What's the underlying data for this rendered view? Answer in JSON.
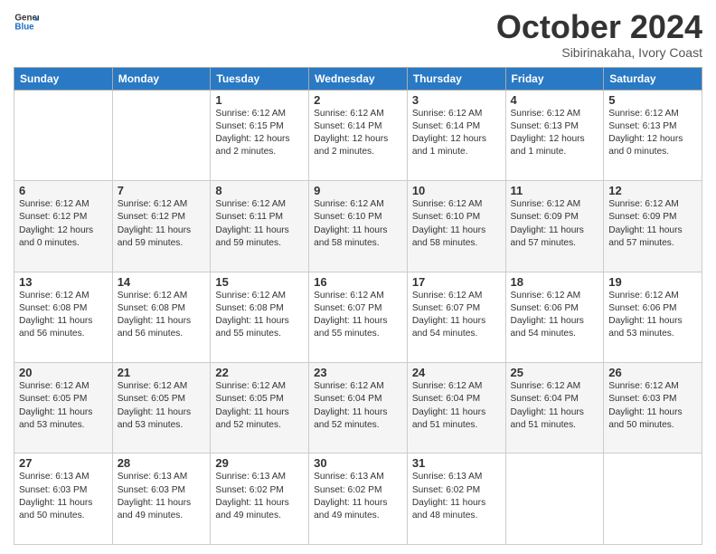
{
  "logo": {
    "line1": "General",
    "line2": "Blue"
  },
  "title": "October 2024",
  "subtitle": "Sibirinakaha, Ivory Coast",
  "weekdays": [
    "Sunday",
    "Monday",
    "Tuesday",
    "Wednesday",
    "Thursday",
    "Friday",
    "Saturday"
  ],
  "weeks": [
    [
      {
        "day": "",
        "info": ""
      },
      {
        "day": "",
        "info": ""
      },
      {
        "day": "1",
        "info": "Sunrise: 6:12 AM\nSunset: 6:15 PM\nDaylight: 12 hours and 2 minutes."
      },
      {
        "day": "2",
        "info": "Sunrise: 6:12 AM\nSunset: 6:14 PM\nDaylight: 12 hours and 2 minutes."
      },
      {
        "day": "3",
        "info": "Sunrise: 6:12 AM\nSunset: 6:14 PM\nDaylight: 12 hours and 1 minute."
      },
      {
        "day": "4",
        "info": "Sunrise: 6:12 AM\nSunset: 6:13 PM\nDaylight: 12 hours and 1 minute."
      },
      {
        "day": "5",
        "info": "Sunrise: 6:12 AM\nSunset: 6:13 PM\nDaylight: 12 hours and 0 minutes."
      }
    ],
    [
      {
        "day": "6",
        "info": "Sunrise: 6:12 AM\nSunset: 6:12 PM\nDaylight: 12 hours and 0 minutes."
      },
      {
        "day": "7",
        "info": "Sunrise: 6:12 AM\nSunset: 6:12 PM\nDaylight: 11 hours and 59 minutes."
      },
      {
        "day": "8",
        "info": "Sunrise: 6:12 AM\nSunset: 6:11 PM\nDaylight: 11 hours and 59 minutes."
      },
      {
        "day": "9",
        "info": "Sunrise: 6:12 AM\nSunset: 6:10 PM\nDaylight: 11 hours and 58 minutes."
      },
      {
        "day": "10",
        "info": "Sunrise: 6:12 AM\nSunset: 6:10 PM\nDaylight: 11 hours and 58 minutes."
      },
      {
        "day": "11",
        "info": "Sunrise: 6:12 AM\nSunset: 6:09 PM\nDaylight: 11 hours and 57 minutes."
      },
      {
        "day": "12",
        "info": "Sunrise: 6:12 AM\nSunset: 6:09 PM\nDaylight: 11 hours and 57 minutes."
      }
    ],
    [
      {
        "day": "13",
        "info": "Sunrise: 6:12 AM\nSunset: 6:08 PM\nDaylight: 11 hours and 56 minutes."
      },
      {
        "day": "14",
        "info": "Sunrise: 6:12 AM\nSunset: 6:08 PM\nDaylight: 11 hours and 56 minutes."
      },
      {
        "day": "15",
        "info": "Sunrise: 6:12 AM\nSunset: 6:08 PM\nDaylight: 11 hours and 55 minutes."
      },
      {
        "day": "16",
        "info": "Sunrise: 6:12 AM\nSunset: 6:07 PM\nDaylight: 11 hours and 55 minutes."
      },
      {
        "day": "17",
        "info": "Sunrise: 6:12 AM\nSunset: 6:07 PM\nDaylight: 11 hours and 54 minutes."
      },
      {
        "day": "18",
        "info": "Sunrise: 6:12 AM\nSunset: 6:06 PM\nDaylight: 11 hours and 54 minutes."
      },
      {
        "day": "19",
        "info": "Sunrise: 6:12 AM\nSunset: 6:06 PM\nDaylight: 11 hours and 53 minutes."
      }
    ],
    [
      {
        "day": "20",
        "info": "Sunrise: 6:12 AM\nSunset: 6:05 PM\nDaylight: 11 hours and 53 minutes."
      },
      {
        "day": "21",
        "info": "Sunrise: 6:12 AM\nSunset: 6:05 PM\nDaylight: 11 hours and 53 minutes."
      },
      {
        "day": "22",
        "info": "Sunrise: 6:12 AM\nSunset: 6:05 PM\nDaylight: 11 hours and 52 minutes."
      },
      {
        "day": "23",
        "info": "Sunrise: 6:12 AM\nSunset: 6:04 PM\nDaylight: 11 hours and 52 minutes."
      },
      {
        "day": "24",
        "info": "Sunrise: 6:12 AM\nSunset: 6:04 PM\nDaylight: 11 hours and 51 minutes."
      },
      {
        "day": "25",
        "info": "Sunrise: 6:12 AM\nSunset: 6:04 PM\nDaylight: 11 hours and 51 minutes."
      },
      {
        "day": "26",
        "info": "Sunrise: 6:12 AM\nSunset: 6:03 PM\nDaylight: 11 hours and 50 minutes."
      }
    ],
    [
      {
        "day": "27",
        "info": "Sunrise: 6:13 AM\nSunset: 6:03 PM\nDaylight: 11 hours and 50 minutes."
      },
      {
        "day": "28",
        "info": "Sunrise: 6:13 AM\nSunset: 6:03 PM\nDaylight: 11 hours and 49 minutes."
      },
      {
        "day": "29",
        "info": "Sunrise: 6:13 AM\nSunset: 6:02 PM\nDaylight: 11 hours and 49 minutes."
      },
      {
        "day": "30",
        "info": "Sunrise: 6:13 AM\nSunset: 6:02 PM\nDaylight: 11 hours and 49 minutes."
      },
      {
        "day": "31",
        "info": "Sunrise: 6:13 AM\nSunset: 6:02 PM\nDaylight: 11 hours and 48 minutes."
      },
      {
        "day": "",
        "info": ""
      },
      {
        "day": "",
        "info": ""
      }
    ]
  ]
}
